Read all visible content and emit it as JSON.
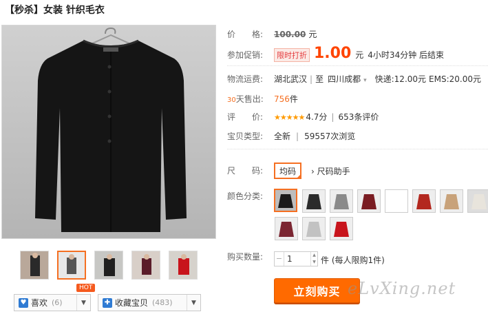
{
  "title": "【秒杀】女装 针织毛衣",
  "price": {
    "label": "价　　格:",
    "original": "100.00",
    "unit": "元"
  },
  "promo": {
    "label": "参加促销:",
    "tag": "限时打折",
    "price": "1.00",
    "unit": "元",
    "countdown": "4小时34分钟 后结束"
  },
  "shipping": {
    "label": "物流运费:",
    "from": "湖北武汉",
    "to_prefix": "至",
    "to": "四川成都",
    "express": "快递:12.00元",
    "ems": "EMS:20.00元"
  },
  "sales": {
    "days": "30",
    "label": "天售出:",
    "value": "756",
    "unit": "件"
  },
  "rating": {
    "label": "评　　价:",
    "stars": "★★★★★",
    "score": "4.7分",
    "reviews": "653条评价"
  },
  "item_type": {
    "label": "宝贝类型:",
    "condition": "全新",
    "views": "59557次浏览"
  },
  "size": {
    "label": "尺　　码:",
    "selected": "均码",
    "help": "尺码助手"
  },
  "color": {
    "label": "颜色分类:"
  },
  "quantity": {
    "label": "购买数量:",
    "value": "1",
    "unit": "件",
    "note": "(每人限购1件)"
  },
  "buy_button": "立刻购买",
  "favorite": {
    "like_label": "喜欢",
    "like_count": "(6)",
    "collect_label": "收藏宝贝",
    "collect_count": "(483)",
    "hot": "HOT"
  },
  "watermark": "eLvXing.net",
  "colors": {
    "accent": "#f56f21",
    "price": "#ff4400",
    "buy": "#ff6a00",
    "swatches": [
      "#1a1a1a",
      "#2b2b2b",
      "#8a8a8a",
      "#7a1c22",
      "#ffffff",
      "#b3281f",
      "#c8a27a",
      "#e8e4dc",
      "#7b2632",
      "#c2c2c2",
      "#c8141c"
    ]
  }
}
